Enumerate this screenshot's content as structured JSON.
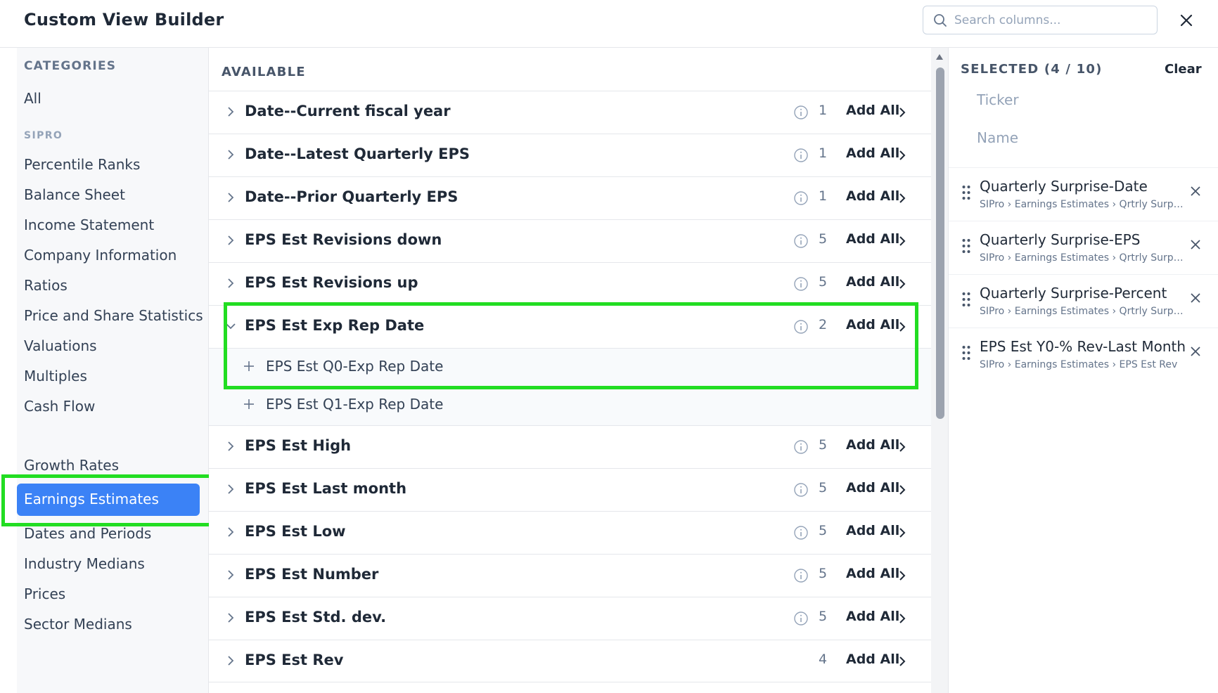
{
  "header": {
    "title": "Custom View Builder",
    "search_placeholder": "Search columns..."
  },
  "categories": {
    "heading": "CATEGORIES",
    "all": "All",
    "group": "SIPRO",
    "items": [
      "Percentile Ranks",
      "Balance Sheet",
      "Income Statement",
      "Company Information",
      "Ratios",
      "Price and Share Statistics",
      "Valuations",
      "Multiples",
      "Cash Flow",
      "Growth Rates",
      "Earnings Estimates",
      "Dates and Periods",
      "Industry Medians",
      "Prices",
      "Sector Medians"
    ],
    "active": "Earnings Estimates"
  },
  "available": {
    "heading": "AVAILABLE",
    "add_all_label": "Add All",
    "rows": [
      {
        "label": "Date--Current fiscal year",
        "count": "1",
        "expanded": false
      },
      {
        "label": "Date--Latest Quarterly EPS",
        "count": "1",
        "expanded": false
      },
      {
        "label": "Date--Prior Quarterly EPS",
        "count": "1",
        "expanded": false
      },
      {
        "label": "EPS Est Revisions down",
        "count": "5",
        "expanded": false
      },
      {
        "label": "EPS Est Revisions up",
        "count": "5",
        "expanded": false
      },
      {
        "label": "EPS Est Exp Rep Date",
        "count": "2",
        "expanded": true,
        "children": [
          "EPS Est Q0-Exp Rep Date",
          "EPS Est Q1-Exp Rep Date"
        ]
      },
      {
        "label": "EPS Est High",
        "count": "5",
        "expanded": false
      },
      {
        "label": "EPS Est Last month",
        "count": "5",
        "expanded": false
      },
      {
        "label": "EPS Est Low",
        "count": "5",
        "expanded": false
      },
      {
        "label": "EPS Est Number",
        "count": "5",
        "expanded": false
      },
      {
        "label": "EPS Est Std. dev.",
        "count": "5",
        "expanded": false
      },
      {
        "label": "EPS Est Rev",
        "count": "4",
        "expanded": false
      }
    ]
  },
  "selected": {
    "heading": "SELECTED (4 / 10)",
    "clear_label": "Clear",
    "fixed": [
      "Ticker",
      "Name"
    ],
    "items": [
      {
        "name": "Quarterly Surprise-Date",
        "path": "SIPro › Earnings Estimates › Qrtrly Surpri..."
      },
      {
        "name": "Quarterly Surprise-EPS",
        "path": "SIPro › Earnings Estimates › Qrtrly Surpri..."
      },
      {
        "name": "Quarterly Surprise-Percent",
        "path": "SIPro › Earnings Estimates › Qrtrly Surpri..."
      },
      {
        "name": "EPS Est Y0-% Rev-Last Month",
        "path": "SIPro › Earnings Estimates › EPS Est Rev"
      }
    ]
  },
  "colors": {
    "accent": "#3b82f6",
    "highlight": "#22dd22"
  }
}
